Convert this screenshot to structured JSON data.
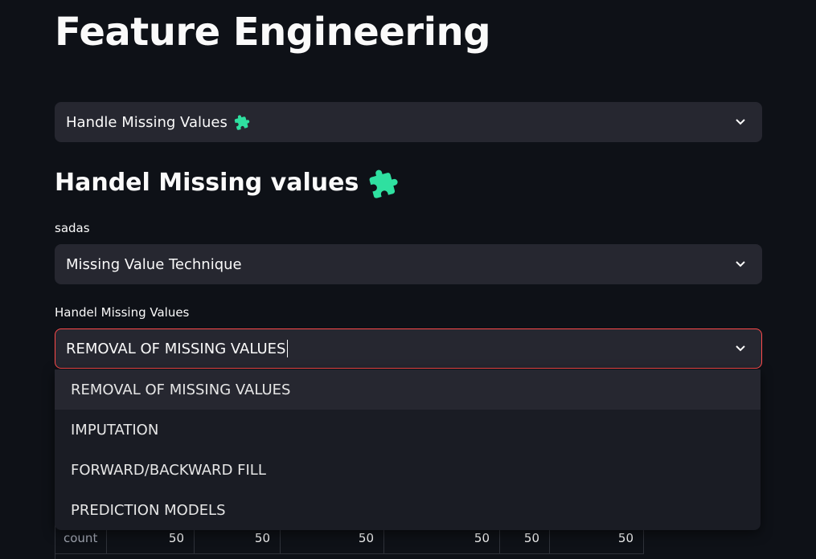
{
  "page": {
    "title": "Feature Engineering"
  },
  "section_select": {
    "value": "Handle Missing Values",
    "icon": "puzzle-icon",
    "icon_color": "#2fe0a0"
  },
  "section": {
    "heading": "Handel Missing values",
    "icon": "puzzle-icon"
  },
  "technique_select": {
    "label": "sadas",
    "value": "Missing Value Technique"
  },
  "handle_select": {
    "label": "Handel Missing Values",
    "value": "REMOVAL OF MISSING VALUES",
    "focus_color": "#ff4b4b"
  },
  "dropdown": {
    "options": [
      "REMOVAL OF MISSING VALUES",
      "IMPUTATION",
      "FORWARD/BACKWARD FILL",
      "PREDICTION MODELS"
    ],
    "highlighted_index": 0
  },
  "table": {
    "row_label": "count",
    "values": [
      "50",
      "50",
      "50",
      "50",
      "50",
      "50"
    ]
  }
}
